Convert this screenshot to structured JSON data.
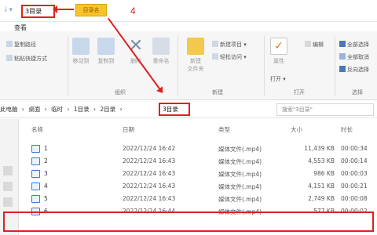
{
  "title_bar": {
    "folder_name": "3目录",
    "callout_text": "目录名",
    "step_number": "4"
  },
  "ribbon": {
    "tab_label": "查看",
    "clipboard": {
      "copy_path": "复制路径",
      "paste_shortcut": "粘贴快捷方式"
    },
    "organize": {
      "move_to": "移动到",
      "copy_to": "复制到",
      "delete": "删除",
      "rename": "重命名",
      "label": "组织"
    },
    "new": {
      "new_item": "新建项目",
      "easy_access": "轻松访问",
      "new_folder_line1": "新建",
      "new_folder_line2": "文件夹",
      "label": "新建"
    },
    "open": {
      "properties": "属性",
      "open": "打开",
      "edit": "编辑",
      "label": "打开"
    },
    "select": {
      "select_all": "全部选择",
      "select_none": "全部取消",
      "invert": "反向选择",
      "label": "选择"
    }
  },
  "address": {
    "crumbs": [
      "此电脑",
      "›",
      "桌面",
      "›",
      "临时",
      "›",
      "1目录",
      "›",
      "2目录",
      "›"
    ],
    "current": "3目录",
    "search_placeholder": "搜索\"3目录\""
  },
  "columns": {
    "name": "名称",
    "date": "日期",
    "type": "类型",
    "size": "大小",
    "duration": "时长"
  },
  "files": [
    {
      "name": "1",
      "date": "2022/12/24 16:42",
      "type": "媒体文件(.mp4)",
      "size": "11,439 KB",
      "duration": "00:00:34"
    },
    {
      "name": "2",
      "date": "2022/12/24 16:43",
      "type": "媒体文件(.mp4)",
      "size": "4,553 KB",
      "duration": "00:00:14"
    },
    {
      "name": "3",
      "date": "2022/12/24 16:43",
      "type": "媒体文件(.mp4)",
      "size": "986 KB",
      "duration": "00:00:03"
    },
    {
      "name": "4",
      "date": "2022/12/24 16:43",
      "type": "媒体文件(.mp4)",
      "size": "4,151 KB",
      "duration": "00:00:21"
    },
    {
      "name": "5",
      "date": "2022/12/24 16:43",
      "type": "媒体文件(.mp4)",
      "size": "2,749 KB",
      "duration": "00:00:08"
    },
    {
      "name": "6",
      "date": "2022/12/24 16:44",
      "type": "媒体文件(.mp4)",
      "size": "577 KB",
      "duration": "00:00:02"
    }
  ],
  "colors": {
    "annotation_red": "#e02020",
    "callout_yellow": "#f5c42a",
    "file_icon_blue": "#3a7bd5"
  }
}
